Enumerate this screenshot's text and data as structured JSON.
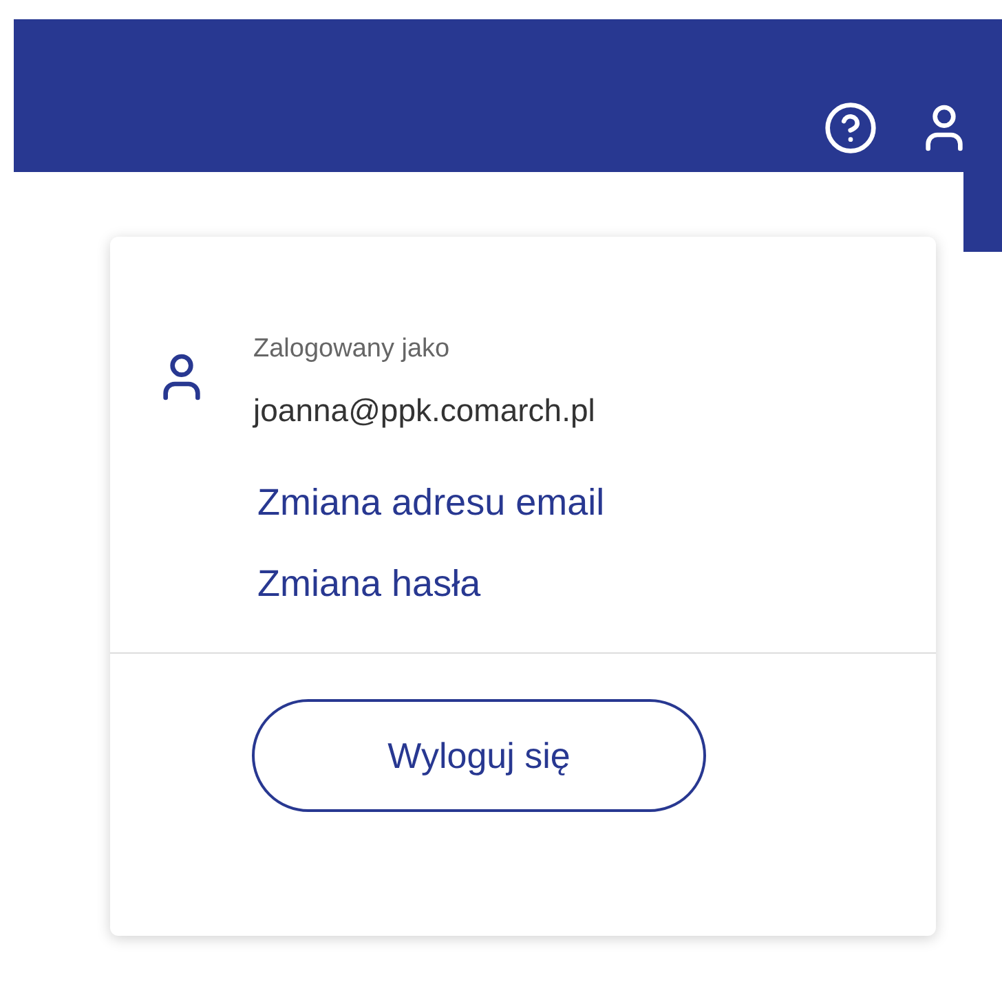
{
  "account_menu": {
    "caption": "Zalogowany jako",
    "email": "joanna@ppk.comarch.pl",
    "links": [
      "Zmiana adresu email",
      "Zmiana hasła"
    ],
    "logout_button": "Wyloguj się"
  }
}
